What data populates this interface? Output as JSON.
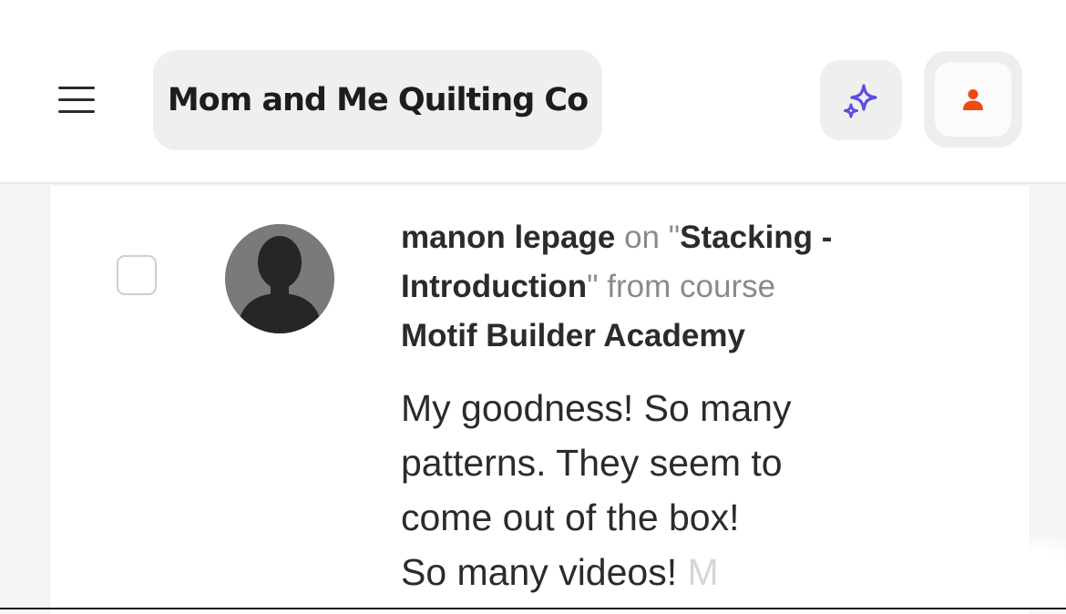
{
  "header": {
    "menu_icon": "hamburger-menu-icon",
    "brand_title": "Mom and Me Quilting Co",
    "ai_icon": "sparkle-icon",
    "user_icon": "user-icon",
    "accent_purple": "#5b4fe0",
    "accent_orange": "#f04a12"
  },
  "comment": {
    "author": "manon lepage",
    "on_label": "on",
    "lesson_open_quote": "\"",
    "lesson_title": "Stacking - Introduction",
    "lesson_close_quote": "\"",
    "from_label": "from course",
    "course_title": "Motif Builder Academy",
    "body_lines": [
      "My goodness! So many",
      "patterns. They seem to",
      "come out of the box!",
      "So many videos!"
    ],
    "truncated_fragment": "M"
  }
}
